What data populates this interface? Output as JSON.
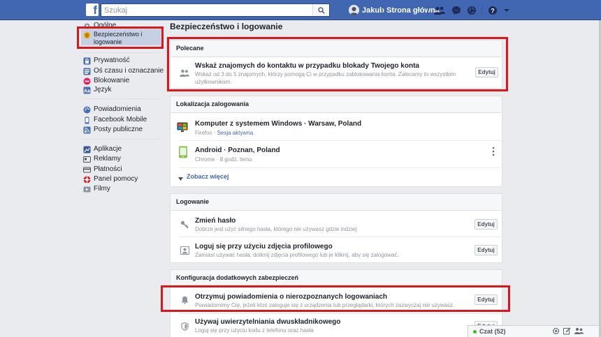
{
  "topbar": {
    "logo_letter": "f",
    "search_placeholder": "Szukaj",
    "user_name": "Jakub",
    "home_label": "Strona główna",
    "brand_color": "#4267b2"
  },
  "leftnav": {
    "general": "Ogólne",
    "security": "Bezpieczeństwo i logowanie",
    "privacy": "Prywatność",
    "timeline": "Oś czasu i oznaczanie",
    "blocking": "Blokowanie",
    "language": "Język",
    "notifications": "Powiadomienia",
    "mobile": "Facebook Mobile",
    "public_posts": "Posty publiczne",
    "apps": "Aplikacje",
    "ads": "Reklamy",
    "payments": "Płatności",
    "support": "Panel pomocy",
    "videos": "Filmy"
  },
  "main": {
    "title": "Bezpieczeństwo i logowanie",
    "edit_label": "Edytuj",
    "recommended": {
      "header": "Polecane",
      "title": "Wskaż znajomych do kontaktu w przypadku blokady Twojego konta",
      "desc": "Wskaż od 3 do 5 znajomych, którzy pomogą Ci w przypadku zablokowania konta. Zalecamy to wszystkim użytkownikom."
    },
    "login_location": {
      "header": "Lokalizacja zalogowania",
      "session1_title": "Komputer z systemem Windows · Warsaw, Poland",
      "session1_browser": "Firefox · ",
      "session1_active": "Sesja aktywna",
      "session2_title": "Android · Poznan, Poland",
      "session2_meta": "Chrome · 8 godz. temu",
      "see_more": "Zobacz więcej"
    },
    "login": {
      "header": "Logowanie",
      "change_pw_title": "Zmień hasło",
      "change_pw_desc": "Dobrze jest użyć silnego hasła, którego nie używasz gdzie indziej",
      "profile_pic_title": "Loguj się przy użyciu zdjęcia profilowego",
      "profile_pic_desc": "Zamiast używać hasła, dotknij zdjęcia profilowego lub je kliknij, aby się zalogować."
    },
    "extra_security": {
      "header": "Konfiguracja dodatkowych zabezpieczeń",
      "alerts_title": "Otrzymuj powiadomienia o nierozpoznanych logowaniach",
      "alerts_desc": "Powiadomimy Cię, jeżeli ktoś zaloguje się z urządzenia lub przeglądarki, których zazwyczaj nie używasz.",
      "twofactor_title": "Używaj uwierzytelniania dwuskładnikowego",
      "twofactor_desc": "Loguj się przy użyciu kodu z telefonu oraz hasła"
    }
  },
  "chat": {
    "label": "Czat (52)"
  },
  "highlight_color": "#e0141b"
}
